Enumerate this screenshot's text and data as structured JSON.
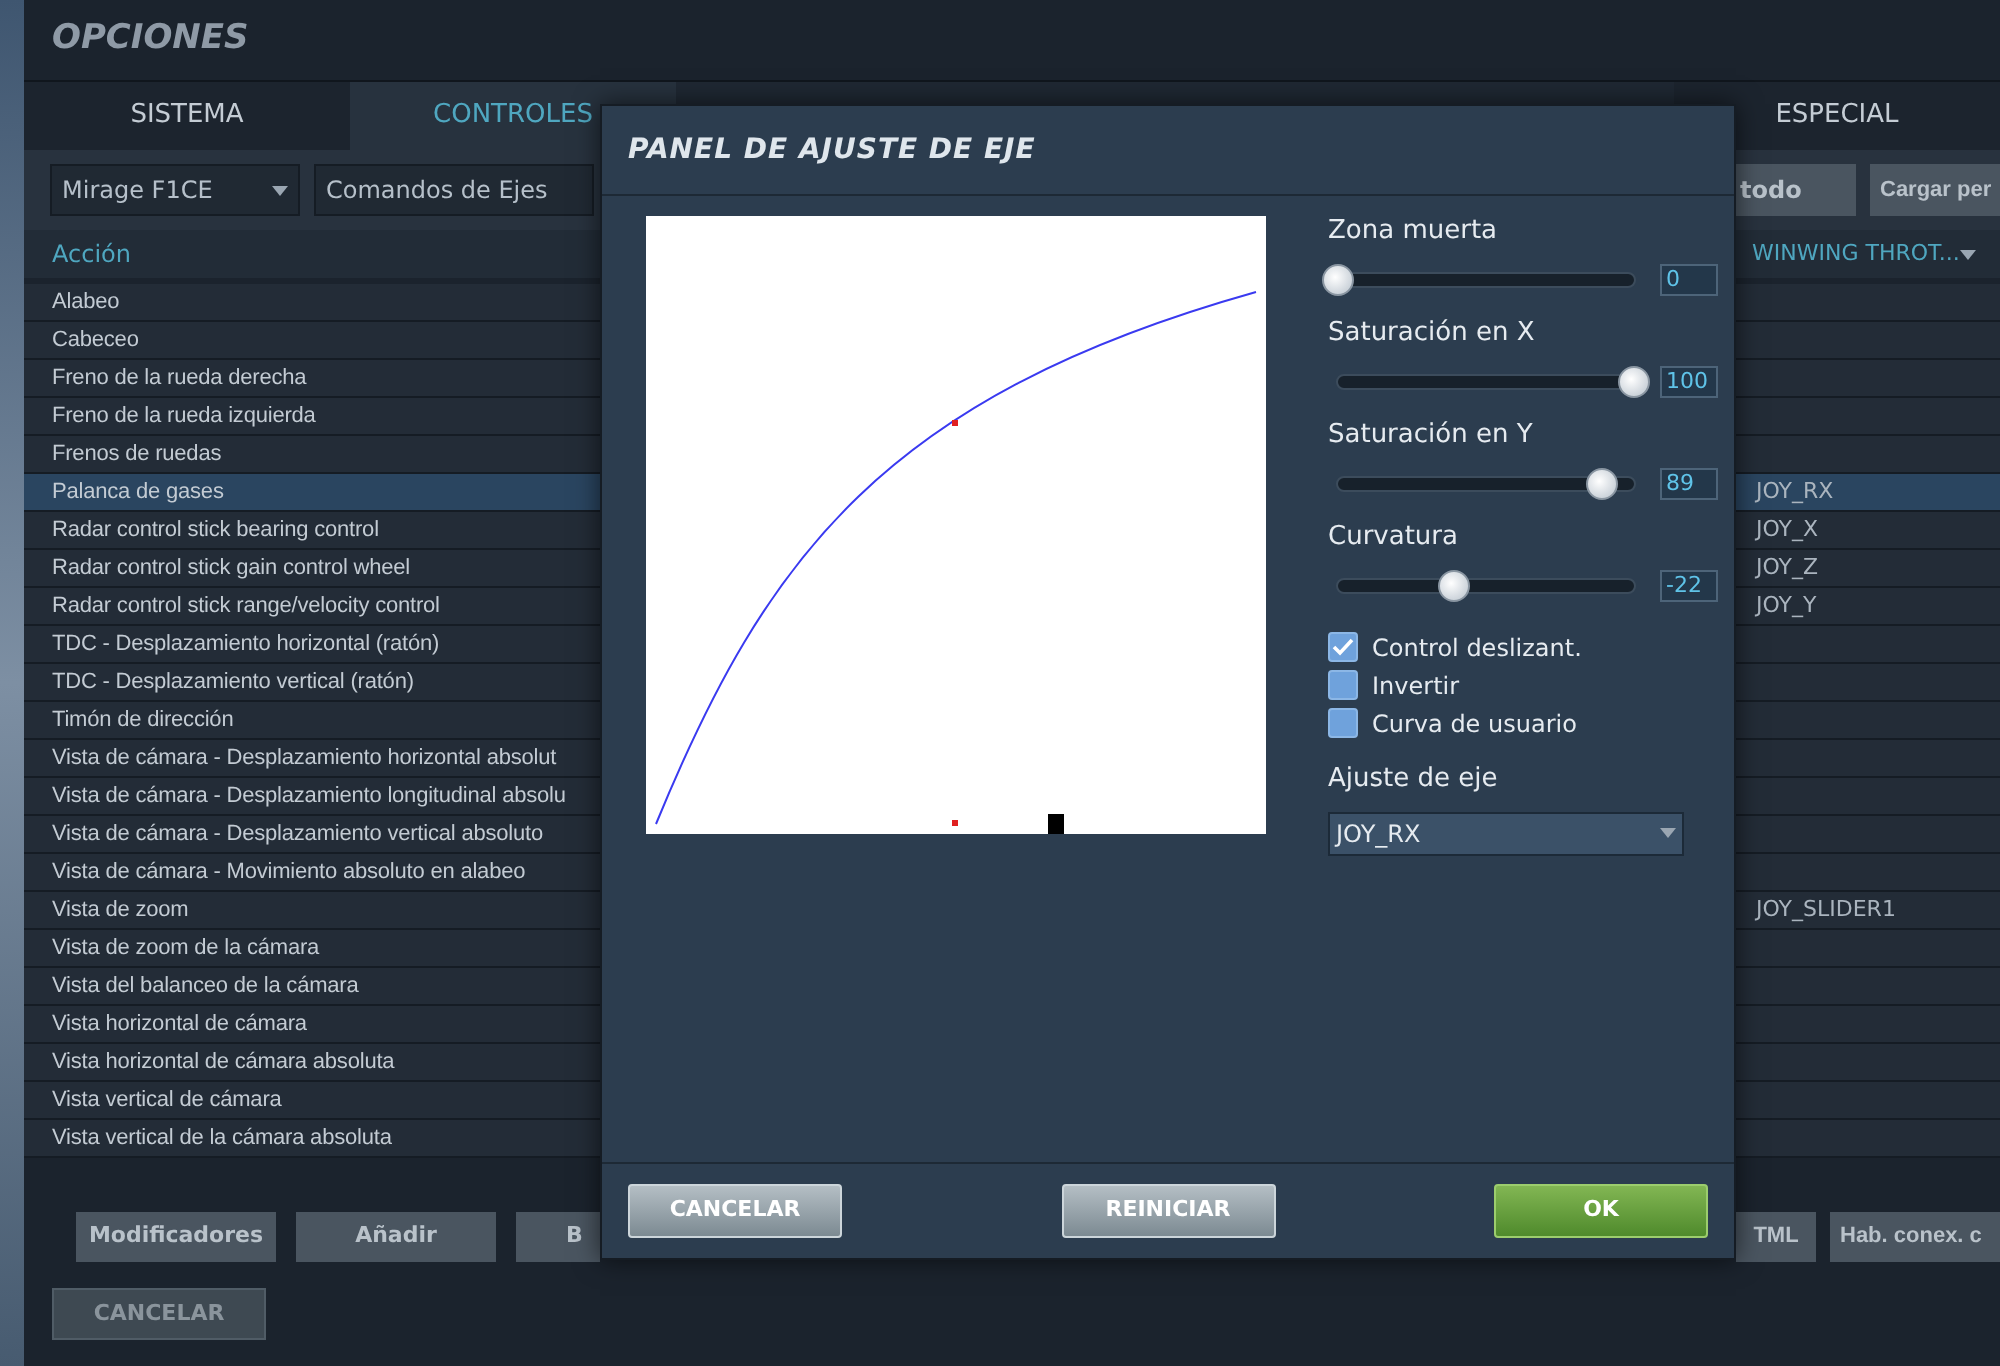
{
  "window": {
    "title": "OPCIONES"
  },
  "tabs": [
    {
      "label": "SISTEMA",
      "selected": false
    },
    {
      "label": "CONTROLES",
      "selected": true
    },
    {
      "label": "ESPECIAL",
      "selected": false
    }
  ],
  "toolbar": {
    "aircraft": "Mirage F1CE",
    "category": "Comandos de Ejes",
    "buttons": [
      "todo",
      "Cargar per"
    ]
  },
  "table": {
    "columns": [
      {
        "label": "Acción"
      },
      {
        "label": "WINWING THROT..."
      }
    ],
    "rows": [
      {
        "action": "Alabeo",
        "selected": false
      },
      {
        "action": "Cabeceo",
        "selected": false
      },
      {
        "action": "Freno de la rueda derecha",
        "selected": false
      },
      {
        "action": "Freno de la rueda izquierda",
        "selected": false
      },
      {
        "action": "Frenos de ruedas",
        "selected": false
      },
      {
        "action": "Palanca de gases",
        "selected": true,
        "binding": "JOY_RX"
      },
      {
        "action": "Radar control stick bearing control",
        "selected": false,
        "binding": "JOY_X"
      },
      {
        "action": "Radar control stick gain control wheel",
        "selected": false,
        "binding": "JOY_Z"
      },
      {
        "action": "Radar control stick range/velocity control",
        "selected": false,
        "binding": "JOY_Y"
      },
      {
        "action": "TDC - Desplazamiento horizontal (ratón)",
        "selected": false
      },
      {
        "action": "TDC - Desplazamiento vertical (ratón)",
        "selected": false
      },
      {
        "action": "Timón de dirección",
        "selected": false
      },
      {
        "action": "Vista de cámara - Desplazamiento horizontal absolut",
        "selected": false
      },
      {
        "action": "Vista de cámara - Desplazamiento longitudinal absolu",
        "selected": false
      },
      {
        "action": "Vista de cámara - Desplazamiento vertical absoluto",
        "selected": false
      },
      {
        "action": "Vista de cámara - Movimiento absoluto en alabeo",
        "selected": false
      },
      {
        "action": "Vista de zoom",
        "selected": false,
        "binding": "JOY_SLIDER1"
      },
      {
        "action": "Vista de zoom de la cámara",
        "selected": false
      },
      {
        "action": "Vista del balanceo de la cámara",
        "selected": false
      },
      {
        "action": "Vista horizontal de cámara",
        "selected": false
      },
      {
        "action": "Vista horizontal de cámara absoluta",
        "selected": false
      },
      {
        "action": "Vista vertical de cámara",
        "selected": false
      },
      {
        "action": "Vista vertical de la cámara absoluta",
        "selected": false
      }
    ]
  },
  "bottom_buttons_left": [
    "Modificadores",
    "Añadir",
    "B"
  ],
  "bottom_buttons_right": [
    "TML",
    "Hab. conex. c"
  ],
  "cancel_button": "CANCELAR",
  "dialog": {
    "title": "PANEL DE AJUSTE DE EJE",
    "sliders": [
      {
        "label": "Zona muerta",
        "level": 0,
        "value": "0"
      },
      {
        "label": "Saturación en X",
        "level": 1,
        "value": "100"
      },
      {
        "label": "Saturación en Y",
        "level": 0.89,
        "value": "89"
      },
      {
        "label": "Curvatura",
        "level": 0.39,
        "value": "-22"
      }
    ],
    "checkboxes": [
      {
        "label": "Control deslizant.",
        "checked": true
      },
      {
        "label": "Invertir",
        "checked": false
      },
      {
        "label": "Curva de usuario",
        "checked": false
      }
    ],
    "axis": {
      "label": "Ajuste de eje",
      "value": "JOY_RX"
    },
    "buttons": [
      {
        "label": "CANCELAR",
        "kind": "secondary"
      },
      {
        "label": "REINICIAR",
        "kind": "secondary"
      },
      {
        "label": "OK",
        "kind": "primary"
      }
    ]
  }
}
